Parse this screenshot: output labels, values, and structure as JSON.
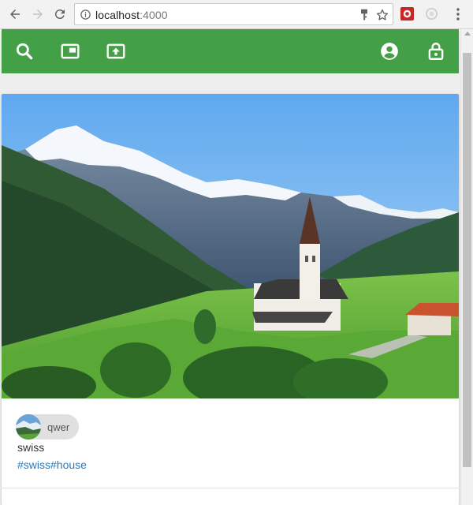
{
  "browser": {
    "url_host": "localhost",
    "url_port": ":4000",
    "back_icon": "arrow-left-icon",
    "forward_icon": "arrow-right-icon",
    "reload_icon": "reload-icon",
    "info_icon": "info-icon",
    "key_icon": "key-icon",
    "star_icon": "star-icon",
    "menu_icon": "kebab-menu-icon"
  },
  "appbar": {
    "color": "#43a047",
    "left_icons": [
      "search-icon",
      "picture-in-picture-icon",
      "upload-icon"
    ],
    "right_icons": [
      "account-circle-icon",
      "lock-open-icon"
    ]
  },
  "post": {
    "author": "qwer",
    "caption": "swiss",
    "tags": "#swiss#house",
    "tag_color": "#2a7bbf"
  }
}
